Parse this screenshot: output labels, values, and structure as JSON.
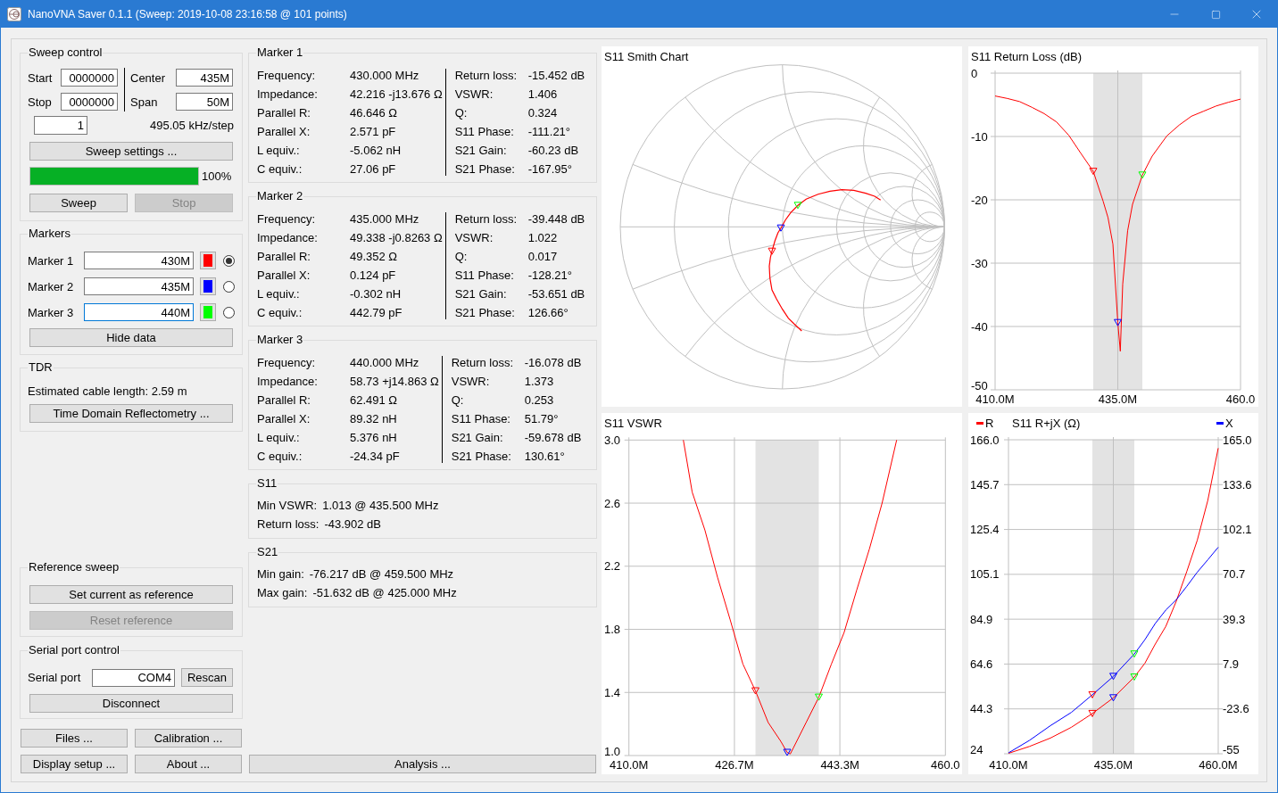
{
  "window": {
    "title": "NanoVNA Saver 0.1.1 (Sweep: 2019-10-08 23:16:58 @ 101 points)"
  },
  "sweep_control": {
    "title": "Sweep control",
    "start": {
      "label": "Start",
      "value": "0000000"
    },
    "stop": {
      "label": "Stop",
      "value": "0000000"
    },
    "center": {
      "label": "Center",
      "value": "435M"
    },
    "span": {
      "label": "Span",
      "value": "50M"
    },
    "segments": "1",
    "step": "495.05 kHz/step",
    "settings_button": "Sweep settings ...",
    "progress": {
      "level": 1,
      "reading": "100%"
    },
    "buttons": [
      {
        "label": "Sweep",
        "disabled": false
      },
      {
        "label": "Stop",
        "disabled": true
      }
    ]
  },
  "markers": {
    "title": "Markers",
    "items": [
      {
        "label": "Marker 1",
        "value": "430M",
        "color": "#ff0000",
        "selected": true,
        "focused": false
      },
      {
        "label": "Marker 2",
        "value": "435M",
        "color": "#0000ff",
        "selected": false,
        "focused": false
      },
      {
        "label": "Marker 3",
        "value": "440M",
        "color": "#00ff00",
        "selected": false,
        "focused": true
      }
    ],
    "hide_button": "Hide data"
  },
  "tdr": {
    "title": "TDR",
    "estimate": "Estimated cable length: 2.59 m",
    "button": "Time Domain Reflectometry ..."
  },
  "reference_sweep": {
    "title": "Reference sweep",
    "buttons": [
      {
        "label": "Set current as reference",
        "disabled": false
      },
      {
        "label": "Reset reference",
        "disabled": true
      }
    ]
  },
  "serial_port": {
    "title": "Serial port control",
    "label": "Serial port",
    "value": "COM4",
    "rescan_button": "Rescan",
    "disconnect_button": "Disconnect"
  },
  "bottom_buttons": [
    "Files ...",
    "Calibration ...",
    "Display setup ...",
    "About ..."
  ],
  "marker_data": [
    {
      "title": "Marker 1",
      "left": [
        {
          "label": "Frequency:",
          "value": "430.000 MHz"
        },
        {
          "label": "Impedance:",
          "value": "42.216 -j13.676 Ω"
        },
        {
          "label": "Parallel R:",
          "value": "46.646 Ω"
        },
        {
          "label": "Parallel X:",
          "value": "2.571 pF"
        },
        {
          "label": "L equiv.:",
          "value": "-5.062 nH"
        },
        {
          "label": "C equiv.:",
          "value": "27.06 pF"
        }
      ],
      "right": [
        {
          "label": "Return loss:",
          "value": "-15.452 dB"
        },
        {
          "label": "VSWR:",
          "value": "1.406"
        },
        {
          "label": "Q:",
          "value": "0.324"
        },
        {
          "label": "S11 Phase:",
          "value": "-111.21°"
        },
        {
          "label": "S21 Gain:",
          "value": "-60.23 dB"
        },
        {
          "label": "S21 Phase:",
          "value": "-167.95°"
        }
      ]
    },
    {
      "title": "Marker 2",
      "left": [
        {
          "label": "Frequency:",
          "value": "435.000 MHz"
        },
        {
          "label": "Impedance:",
          "value": "49.338 -j0.8263 Ω"
        },
        {
          "label": "Parallel R:",
          "value": "49.352 Ω"
        },
        {
          "label": "Parallel X:",
          "value": "0.124 pF"
        },
        {
          "label": "L equiv.:",
          "value": "-0.302 nH"
        },
        {
          "label": "C equiv.:",
          "value": "442.79 pF"
        }
      ],
      "right": [
        {
          "label": "Return loss:",
          "value": "-39.448 dB"
        },
        {
          "label": "VSWR:",
          "value": "1.022"
        },
        {
          "label": "Q:",
          "value": "0.017"
        },
        {
          "label": "S11 Phase:",
          "value": "-128.21°"
        },
        {
          "label": "S21 Gain:",
          "value": "-53.651 dB"
        },
        {
          "label": "S21 Phase:",
          "value": "126.66°"
        }
      ]
    },
    {
      "title": "Marker 3",
      "left": [
        {
          "label": "Frequency:",
          "value": "440.000 MHz"
        },
        {
          "label": "Impedance:",
          "value": "58.73 +j14.863 Ω"
        },
        {
          "label": "Parallel R:",
          "value": "62.491 Ω"
        },
        {
          "label": "Parallel X:",
          "value": "89.32 nH"
        },
        {
          "label": "L equiv.:",
          "value": "5.376 nH"
        },
        {
          "label": "C equiv.:",
          "value": "-24.34 pF"
        }
      ],
      "right": [
        {
          "label": "Return loss:",
          "value": "-16.078 dB"
        },
        {
          "label": "VSWR:",
          "value": "1.373"
        },
        {
          "label": "Q:",
          "value": "0.253"
        },
        {
          "label": "S11 Phase:",
          "value": "51.79°"
        },
        {
          "label": "S21 Gain:",
          "value": "-59.678 dB"
        },
        {
          "label": "S21 Phase:",
          "value": "130.61°"
        }
      ]
    }
  ],
  "s11": {
    "title": "S11",
    "rows": [
      {
        "label": "Min VSWR:",
        "value": "1.013 @ 435.500 MHz"
      },
      {
        "label": "Return loss:",
        "value": "-43.902 dB"
      }
    ]
  },
  "s21": {
    "title": "S21",
    "rows": [
      {
        "label": "Min gain:",
        "value": "-76.217 dB @ 459.500 MHz"
      },
      {
        "label": "Max gain:",
        "value": "-51.632 dB @ 425.000 MHz"
      }
    ]
  },
  "analysis_button": "Analysis ...",
  "charts": {
    "smith": {
      "title": "S11 Smith Chart"
    },
    "return_loss": {
      "chart_data": {
        "type": "line",
        "title": "S11 Return Loss (dB)",
        "grid": true,
        "x": [
          410,
          412.5,
          415,
          417.5,
          420,
          422.5,
          425,
          427.5,
          430,
          432,
          433,
          434,
          435,
          435.5,
          436,
          437,
          438,
          440,
          442,
          445,
          447.5,
          450,
          452.5,
          455,
          457.5,
          460
        ],
        "series": [
          {
            "color": "#ff0000",
            "values": [
              -3.6,
              -4.0,
              -4.5,
              -5.4,
              -6.4,
              -7.7,
              -9.8,
              -12.7,
              -15.5,
              -20.2,
              -22.8,
              -27.0,
              -39.4,
              -43.9,
              -33.3,
              -24.9,
              -20.7,
              -16.1,
              -13.1,
              -9.9,
              -8.2,
              -6.8,
              -6.0,
              -5.2,
              -4.6,
              -4.1
            ]
          },
          {
            "type": "scatter",
            "color": "#ff0000",
            "values": [
              null,
              null,
              null,
              null,
              null,
              null,
              null,
              null,
              -15.5,
              null,
              null,
              null,
              null,
              null,
              null,
              null,
              null,
              null,
              null,
              null,
              null,
              null,
              null,
              null,
              null,
              null
            ]
          },
          {
            "type": "scatter",
            "color": "#0000ff",
            "values": [
              null,
              null,
              null,
              null,
              null,
              null,
              null,
              null,
              null,
              null,
              null,
              null,
              -39.4,
              null,
              null,
              null,
              null,
              null,
              null,
              null,
              null,
              null,
              null,
              null,
              null,
              null
            ]
          },
          {
            "type": "scatter",
            "color": "#00ff00",
            "values": [
              null,
              null,
              null,
              null,
              null,
              null,
              null,
              null,
              null,
              null,
              null,
              null,
              null,
              null,
              null,
              null,
              null,
              -16.1,
              null,
              null,
              null,
              null,
              null,
              null,
              null,
              null
            ]
          }
        ],
        "xlim": [
          410,
          460
        ],
        "ylim": [
          -50,
          0
        ],
        "xticks": [
          {
            "value": 410,
            "label": "410.0M"
          },
          {
            "value": 435,
            "label": "435.0M"
          },
          {
            "value": 460,
            "label": "460.0"
          }
        ],
        "yticks": [
          {
            "value": 0,
            "label": "0"
          },
          {
            "value": -10,
            "label": "-10"
          },
          {
            "value": -20,
            "label": "-20"
          },
          {
            "value": -30,
            "label": "-30"
          },
          {
            "value": -40,
            "label": "-40"
          },
          {
            "value": -50,
            "label": "-50"
          }
        ],
        "bands": [
          {
            "axis": "x",
            "from": 430,
            "to": 440
          }
        ]
      }
    },
    "vswr": {
      "chart_data": {
        "type": "line",
        "title": "S11 VSWR",
        "grid": true,
        "x": [
          418.6,
          420,
          422,
          424,
          426,
          428,
          430,
          432,
          434,
          435,
          435.5,
          436,
          438,
          440,
          442,
          444,
          446,
          448,
          450,
          452.3
        ],
        "series": [
          {
            "color": "#ff0000",
            "values": [
              3.0,
              2.67,
              2.43,
              2.13,
              1.86,
              1.58,
              1.41,
              1.21,
              1.09,
              1.02,
              1.01,
              1.05,
              1.21,
              1.37,
              1.58,
              1.78,
              2.05,
              2.31,
              2.6,
              3.0
            ]
          },
          {
            "type": "scatter",
            "color": "#ff0000",
            "values": [
              null,
              null,
              null,
              null,
              null,
              null,
              1.41,
              null,
              null,
              null,
              null,
              null,
              null,
              null,
              null,
              null,
              null,
              null,
              null,
              null
            ]
          },
          {
            "type": "scatter",
            "color": "#0000ff",
            "values": [
              null,
              null,
              null,
              null,
              null,
              null,
              null,
              null,
              null,
              1.02,
              null,
              null,
              null,
              null,
              null,
              null,
              null,
              null,
              null,
              null
            ]
          },
          {
            "type": "scatter",
            "color": "#00ff00",
            "values": [
              null,
              null,
              null,
              null,
              null,
              null,
              null,
              null,
              null,
              null,
              null,
              null,
              null,
              1.37,
              null,
              null,
              null,
              null,
              null,
              null
            ]
          }
        ],
        "xlim": [
          410,
          460
        ],
        "ylim": [
          1,
          3
        ],
        "xticks": [
          {
            "value": 410,
            "label": "410.0M"
          },
          {
            "value": 426.67,
            "label": "426.7M"
          },
          {
            "value": 443.33,
            "label": "443.3M"
          },
          {
            "value": 460,
            "label": "460.0"
          }
        ],
        "yticks": [
          {
            "value": 3,
            "label": "3.0"
          },
          {
            "value": 2.6,
            "label": "2.6"
          },
          {
            "value": 2.2,
            "label": "2.2"
          },
          {
            "value": 1.8,
            "label": "1.8"
          },
          {
            "value": 1.4,
            "label": "1.4"
          },
          {
            "value": 1,
            "label": "1.0"
          }
        ],
        "bands": [
          {
            "axis": "x",
            "from": 430,
            "to": 440
          }
        ]
      }
    },
    "impedance": {
      "chart_data": {
        "type": "line",
        "title": "S11 R+jX (Ω)",
        "grid": true,
        "legend": "top",
        "x": [
          410,
          415,
          420,
          425,
          430,
          435,
          440,
          442.5,
          445,
          447.5,
          450,
          452.5,
          455,
          457.5,
          460
        ],
        "series": [
          {
            "name": "R",
            "color": "#ff0000",
            "values": [
              24.2,
              27.3,
              31.1,
              36.0,
              42.2,
              49.3,
              58.7,
              64.9,
              73.6,
              81.6,
              93.0,
              106.4,
              120.5,
              138.5,
              162.2
            ]
          },
          {
            "name": "X",
            "color": "#0000ff",
            "axis": "y2",
            "values": [
              -54.4,
              -45.6,
              -35.3,
              -26.0,
              -13.7,
              -0.8,
              14.9,
              24.9,
              36.3,
              45.7,
              52.9,
              62.3,
              72.2,
              80.9,
              89.7
            ]
          },
          {
            "type": "scatter",
            "color": "#ff0000",
            "values": [
              null,
              null,
              null,
              null,
              42.2,
              null,
              null,
              null,
              null,
              null,
              null,
              null,
              null,
              null,
              null
            ]
          },
          {
            "type": "scatter",
            "color": "#ff0000",
            "axis": "y2",
            "values": [
              null,
              null,
              null,
              null,
              -13.7,
              null,
              null,
              null,
              null,
              null,
              null,
              null,
              null,
              null,
              null
            ]
          },
          {
            "type": "scatter",
            "color": "#0000ff",
            "values": [
              null,
              null,
              null,
              null,
              null,
              49.3,
              null,
              null,
              null,
              null,
              null,
              null,
              null,
              null,
              null
            ]
          },
          {
            "type": "scatter",
            "color": "#0000ff",
            "axis": "y2",
            "values": [
              null,
              null,
              null,
              null,
              null,
              -0.8,
              null,
              null,
              null,
              null,
              null,
              null,
              null,
              null,
              null
            ]
          },
          {
            "type": "scatter",
            "color": "#00ff00",
            "values": [
              null,
              null,
              null,
              null,
              null,
              null,
              58.7,
              null,
              null,
              null,
              null,
              null,
              null,
              null,
              null
            ]
          },
          {
            "type": "scatter",
            "color": "#00ff00",
            "axis": "y2",
            "values": [
              null,
              null,
              null,
              null,
              null,
              null,
              14.9,
              null,
              null,
              null,
              null,
              null,
              null,
              null,
              null
            ]
          }
        ],
        "xlim": [
          410,
          460
        ],
        "ylim": [
          24,
          166
        ],
        "y2lim": [
          -55,
          165
        ],
        "xticks": [
          {
            "value": 410,
            "label": "410.0M"
          },
          {
            "value": 435,
            "label": "435.0M"
          },
          {
            "value": 460,
            "label": "460.0M"
          }
        ],
        "yticks": [
          {
            "value": 166,
            "label": "166.0"
          },
          {
            "value": 145.71,
            "label": "145.7"
          },
          {
            "value": 125.43,
            "label": "125.4"
          },
          {
            "value": 105.14,
            "label": "105.1"
          },
          {
            "value": 84.86,
            "label": "84.9"
          },
          {
            "value": 64.57,
            "label": "64.6"
          },
          {
            "value": 44.29,
            "label": "44.3"
          },
          {
            "value": 24,
            "label": "24"
          }
        ],
        "y2ticks": [
          {
            "value": 165,
            "label": "165.0"
          },
          {
            "value": 133.57,
            "label": "133.6"
          },
          {
            "value": 102.14,
            "label": "102.1"
          },
          {
            "value": 70.71,
            "label": "70.7"
          },
          {
            "value": 39.29,
            "label": "39.3"
          },
          {
            "value": 7.86,
            "label": "7.9"
          },
          {
            "value": -23.57,
            "label": "-23.6"
          },
          {
            "value": -55,
            "label": "-55"
          }
        ],
        "bands": [
          {
            "axis": "x",
            "from": 430,
            "to": 440
          }
        ]
      }
    }
  }
}
